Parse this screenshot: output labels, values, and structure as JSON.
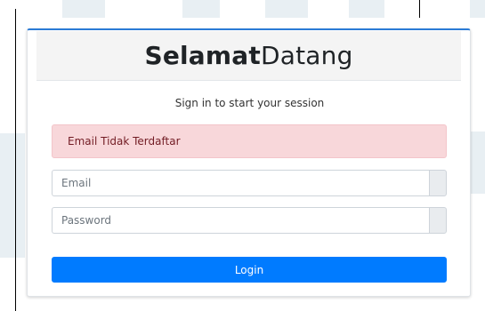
{
  "header": {
    "title_bold": "Selamat",
    "title_regular": "Datang"
  },
  "login": {
    "subtitle": "Sign in to start your session",
    "alert_message": "Email Tidak Terdaftar",
    "email_placeholder": "Email",
    "password_placeholder": "Password",
    "login_label": "Login"
  },
  "colors": {
    "accent": "#007bff",
    "card_top_border": "#2b7bd6",
    "alert_background": "#f8d7da",
    "alert_text": "#721c24"
  }
}
